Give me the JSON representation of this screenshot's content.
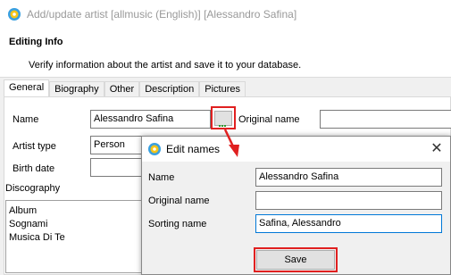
{
  "window": {
    "title": "Add/update artist [allmusic (English)] [Alessandro Safina]"
  },
  "header": {
    "title": "Editing Info",
    "subtitle": "Verify information about the artist and save it to your database."
  },
  "tabs": [
    {
      "label": "General",
      "active": true
    },
    {
      "label": "Biography",
      "active": false
    },
    {
      "label": "Other",
      "active": false
    },
    {
      "label": "Description",
      "active": false
    },
    {
      "label": "Pictures",
      "active": false
    }
  ],
  "form": {
    "name_label": "Name",
    "name_value": "Alessandro Safina",
    "original_name_label": "Original name",
    "original_name_value": "",
    "artist_type_label": "Artist type",
    "artist_type_value": "Person",
    "birth_date_label": "Birth date",
    "birth_date_value": "",
    "ellipsis_button_icon": "ellipsis-icon"
  },
  "discography": {
    "label": "Discography",
    "items": [
      "Album",
      "Sognami",
      "Musica Di Te"
    ]
  },
  "dialog": {
    "title": "Edit names",
    "name_label": "Name",
    "name_value": "Alessandro Safina",
    "original_name_label": "Original name",
    "original_name_value": "",
    "sorting_name_label": "Sorting name",
    "sorting_name_value": "Safina, Alessandro",
    "save_label": "Save",
    "close_icon": "close-icon"
  },
  "colors": {
    "highlight": "#e02020",
    "accent": "#0078d7"
  }
}
